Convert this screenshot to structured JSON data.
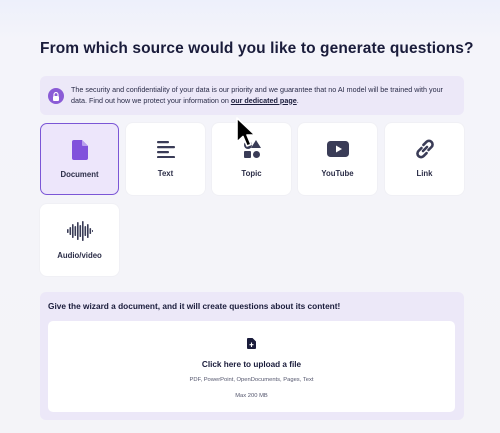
{
  "page": {
    "title": "From which source would you like to generate questions?"
  },
  "notice": {
    "icon": "lock-icon",
    "text": "The security and confidentiality of your data is our priority and we guarantee that no AI model will be trained with your data. Find out how we protect your information on ",
    "link_label": "our dedicated page",
    "suffix": "."
  },
  "sources": [
    {
      "label": "Document",
      "icon": "document-icon",
      "selected": true
    },
    {
      "label": "Text",
      "icon": "text-lines-icon",
      "selected": false
    },
    {
      "label": "Topic",
      "icon": "topic-shapes-icon",
      "selected": false
    },
    {
      "label": "YouTube",
      "icon": "youtube-icon",
      "selected": false
    },
    {
      "label": "Link",
      "icon": "link-icon",
      "selected": false
    },
    {
      "label": "Audio/video",
      "icon": "audio-wave-icon",
      "selected": false
    }
  ],
  "wizard": {
    "title": "Give the wizard a document, and it will create questions about its content!",
    "upload_title": "Click here to upload a file",
    "formats": "PDF, PowerPoint, OpenDocuments, Pages, Text",
    "max_size": "Max 200 MB"
  },
  "colors": {
    "accent": "#7b56d6",
    "selected_bg": "#ede6fb",
    "panel_bg": "#ece8f8",
    "icon_dark": "#3a3c57"
  }
}
